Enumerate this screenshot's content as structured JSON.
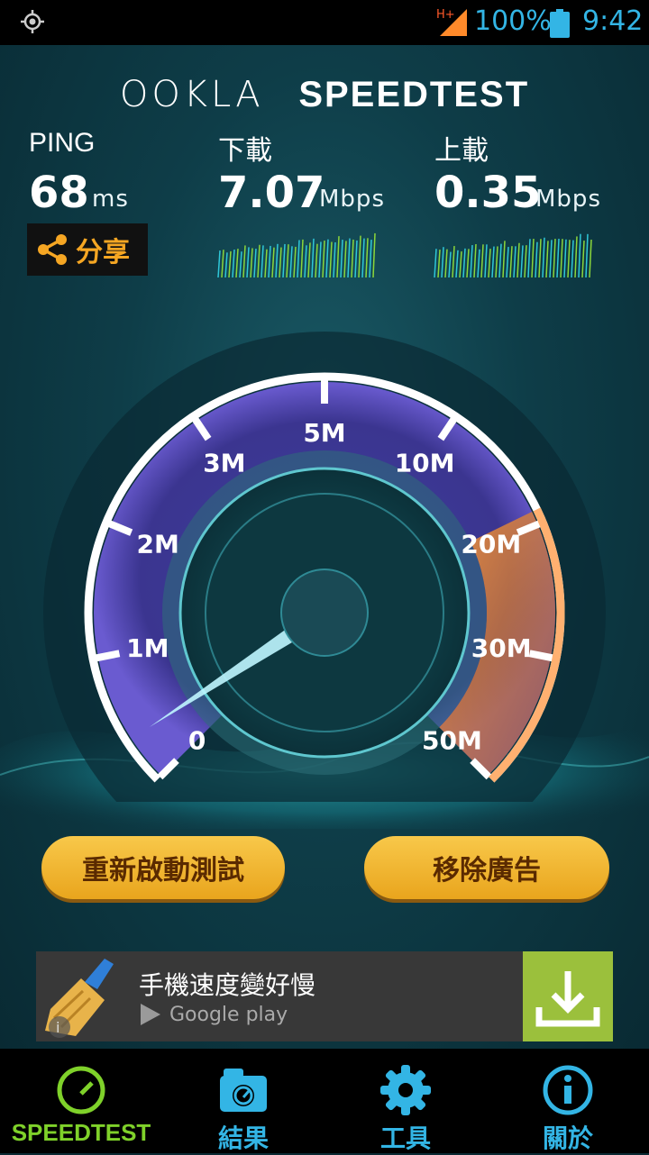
{
  "status_bar": {
    "network": "H+",
    "battery": "100%",
    "time": "9:42"
  },
  "header": {
    "logo_left": "OOKLA",
    "logo_right": "SPEEDTEST"
  },
  "metrics": {
    "ping": {
      "label": "PING",
      "value": "68",
      "unit": "ms"
    },
    "download": {
      "label": "下載",
      "value": "7.07",
      "unit": "Mbps"
    },
    "upload": {
      "label": "上載",
      "value": "0.35",
      "unit": "Mbps"
    }
  },
  "share": {
    "label": "分享",
    "icon": "share-icon"
  },
  "gauge": {
    "labels": [
      "0",
      "1M",
      "2M",
      "3M",
      "5M",
      "10M",
      "20M",
      "30M",
      "50M"
    ],
    "needle_value_mbps": 0.35,
    "accent": "#ff8a2a"
  },
  "buttons": {
    "restart": "重新啟動測試",
    "remove_ads": "移除廣告"
  },
  "ad": {
    "title": "手機速度變好慢",
    "store": "Google play"
  },
  "nav": [
    {
      "label": "SPEEDTEST",
      "icon": "speedometer-icon",
      "active": true
    },
    {
      "label": "結果",
      "icon": "results-icon",
      "active": false
    },
    {
      "label": "工具",
      "icon": "gear-icon",
      "active": false
    },
    {
      "label": "關於",
      "icon": "info-icon",
      "active": false
    }
  ],
  "colors": {
    "accent_blue": "#33b5e5",
    "accent_green": "#7fd12a",
    "button_gold": "#f5b836"
  }
}
